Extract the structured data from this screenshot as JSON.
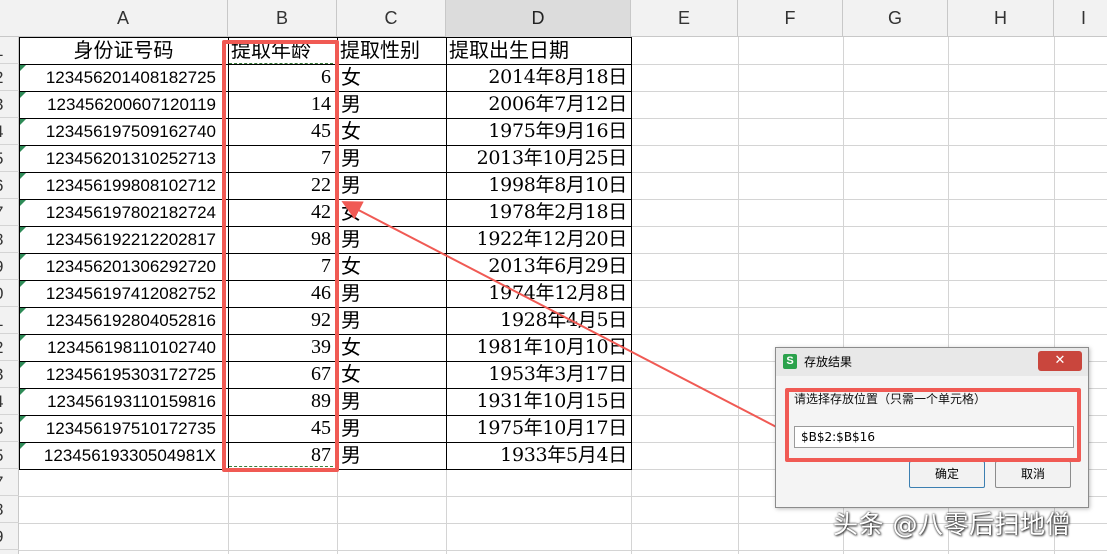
{
  "columns": [
    "A",
    "B",
    "C",
    "D",
    "E",
    "F",
    "G",
    "H",
    "I"
  ],
  "rows": [
    "1",
    "2",
    "3",
    "4",
    "5",
    "6",
    "7",
    "8",
    "9",
    "0",
    "1",
    "2",
    "3",
    "4",
    "5",
    "5",
    "7",
    "8",
    "9"
  ],
  "table": {
    "headers": {
      "id": "身份证号码",
      "age": "提取年龄",
      "sex": "提取性别",
      "birth": "提取出生日期"
    },
    "records": [
      {
        "id": "123456201408182725",
        "age": "6",
        "sex": "女",
        "birth": "2014年8月18日"
      },
      {
        "id": "123456200607120119",
        "age": "14",
        "sex": "男",
        "birth": "2006年7月12日"
      },
      {
        "id": "123456197509162740",
        "age": "45",
        "sex": "女",
        "birth": "1975年9月16日"
      },
      {
        "id": "123456201310252713",
        "age": "7",
        "sex": "男",
        "birth": "2013年10月25日"
      },
      {
        "id": "123456199808102712",
        "age": "22",
        "sex": "男",
        "birth": "1998年8月10日"
      },
      {
        "id": "123456197802182724",
        "age": "42",
        "sex": "女",
        "birth": "1978年2月18日"
      },
      {
        "id": "123456192212202817",
        "age": "98",
        "sex": "男",
        "birth": "1922年12月20日"
      },
      {
        "id": "123456201306292720",
        "age": "7",
        "sex": "女",
        "birth": "2013年6月29日"
      },
      {
        "id": "123456197412082752",
        "age": "46",
        "sex": "男",
        "birth": "1974年12月8日"
      },
      {
        "id": "123456192804052816",
        "age": "92",
        "sex": "男",
        "birth": "1928年4月5日"
      },
      {
        "id": "123456198110102740",
        "age": "39",
        "sex": "女",
        "birth": "1981年10月10日"
      },
      {
        "id": "123456195303172725",
        "age": "67",
        "sex": "女",
        "birth": "1953年3月17日"
      },
      {
        "id": "123456193110159816",
        "age": "89",
        "sex": "男",
        "birth": "1931年10月15日"
      },
      {
        "id": "123456197510172735",
        "age": "45",
        "sex": "男",
        "birth": "1975年10月17日"
      },
      {
        "id": "12345619330504981X",
        "age": "87",
        "sex": "男",
        "birth": "1933年5月4日"
      }
    ]
  },
  "dialog": {
    "icon_letter": "S",
    "title": "存放结果",
    "close_label": "✕",
    "prompt": "请选择存放位置（只需一个单元格）",
    "input_value": "$B$2:$B$16",
    "ok_label": "确定",
    "cancel_label": "取消"
  },
  "watermark": "头条 @八零后扫地僧",
  "colors": {
    "highlight": "#f05a54",
    "marching_ants": "#3a7d3a",
    "close_button": "#c9463d",
    "sheet_icon": "#2ba24c"
  },
  "icons": {
    "dialog_icon": "wps-spreadsheet-icon",
    "close_icon": "close-icon"
  }
}
